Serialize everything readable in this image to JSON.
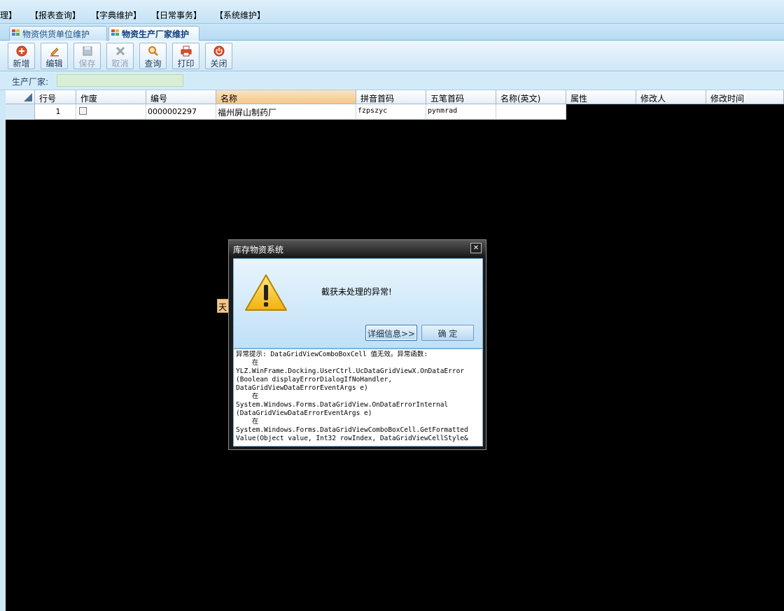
{
  "menu": {
    "items": [
      "理】",
      "【报表查询】",
      "【字典维护】",
      "【日常事务】",
      "【系统维护】"
    ]
  },
  "tabs": [
    {
      "label": "物资供货单位维护",
      "active": false
    },
    {
      "label": "物资生产厂家维护",
      "active": true
    }
  ],
  "toolbar": {
    "buttons": [
      {
        "label": "新增",
        "icon": "add-icon",
        "enabled": true
      },
      {
        "label": "编辑",
        "icon": "edit-icon",
        "enabled": true
      },
      {
        "label": "保存",
        "icon": "save-icon",
        "enabled": false
      },
      {
        "label": "取消",
        "icon": "cancel-icon",
        "enabled": false
      },
      {
        "label": "查询",
        "icon": "search-icon",
        "enabled": true
      },
      {
        "label": "打印",
        "icon": "print-icon",
        "enabled": true
      },
      {
        "label": "关闭",
        "icon": "power-icon",
        "enabled": true
      }
    ]
  },
  "filter": {
    "label": "生产厂家:",
    "value": ""
  },
  "grid": {
    "columns": [
      "行号",
      "作废",
      "编号",
      "名称",
      "拼音首码",
      "五笔首码",
      "名称(英文)",
      "属性",
      "修改人",
      "修改时间"
    ],
    "selected_column": "名称",
    "rows": [
      {
        "row_no": "1",
        "void": false,
        "code": "0000002297",
        "name": "福州屏山制药厂",
        "pinyin": "fzpszyc",
        "wubi": "pynmrad",
        "name_en": ""
      }
    ],
    "fragment_text": "天"
  },
  "dialog": {
    "title": "库存物资系统",
    "message": "截获未处理的异常!",
    "details_button": "详细信息>>",
    "ok_button": "确    定",
    "detail_text": "异常提示: DataGridViewComboBoxCell 值无效。异常函数:\n    在\nYLZ.WinFrame.Docking.UserCtrl.UcDataGridViewX.OnDataError\n(Boolean displayErrorDialogIfNoHandler,\nDataGridViewDataErrorEventArgs e)\n    在\nSystem.Windows.Forms.DataGridView.OnDataErrorInternal\n(DataGridViewDataErrorEventArgs e)\n    在\nSystem.Windows.Forms.DataGridViewComboBoxCell.GetFormatted\nValue(Object value, Int32 rowIndex, DataGridViewCellStyle&"
  },
  "colors": {
    "background": "#cfe8f7",
    "header_selected": "#f6c888",
    "filter_input": "#d9efd5",
    "dialog_title": "#1c1c1c"
  }
}
